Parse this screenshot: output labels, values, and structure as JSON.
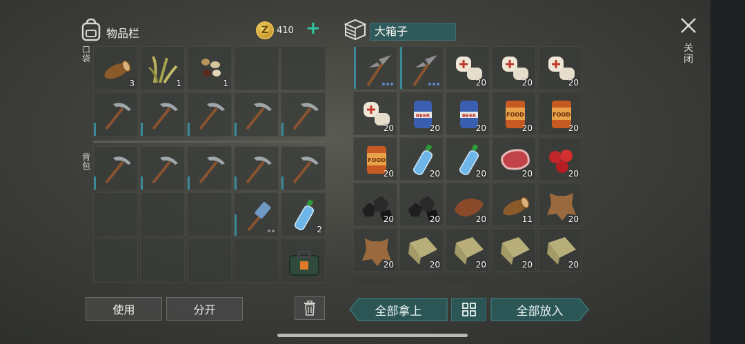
{
  "inventory": {
    "title": "物品栏",
    "coins": "410",
    "coin_symbol": "Z",
    "pocket_label": "口袋",
    "backpack_label": "背包",
    "pocket_row1": [
      {
        "item": "log",
        "qty": "3"
      },
      {
        "item": "plant-fiber",
        "qty": "1"
      },
      {
        "item": "seeds",
        "qty": "1"
      },
      {
        "item": "empty",
        "qty": ""
      },
      {
        "item": "empty",
        "qty": ""
      }
    ],
    "pocket_row2": [
      {
        "item": "pickaxe",
        "qty": ""
      },
      {
        "item": "pickaxe",
        "qty": ""
      },
      {
        "item": "pickaxe",
        "qty": ""
      },
      {
        "item": "pickaxe",
        "qty": ""
      },
      {
        "item": "pickaxe",
        "qty": ""
      }
    ],
    "backpack_row1": [
      {
        "item": "pickaxe",
        "qty": ""
      },
      {
        "item": "pickaxe",
        "qty": ""
      },
      {
        "item": "pickaxe",
        "qty": ""
      },
      {
        "item": "pickaxe",
        "qty": ""
      },
      {
        "item": "pickaxe",
        "qty": ""
      }
    ],
    "backpack_row2": [
      {
        "item": "empty",
        "qty": ""
      },
      {
        "item": "empty",
        "qty": ""
      },
      {
        "item": "empty",
        "qty": ""
      },
      {
        "item": "hammer",
        "qty": ""
      },
      {
        "item": "water-bottle",
        "qty": "2"
      }
    ],
    "backpack_row3": [
      {
        "item": "empty",
        "qty": ""
      },
      {
        "item": "empty",
        "qty": ""
      },
      {
        "item": "empty",
        "qty": ""
      },
      {
        "item": "empty",
        "qty": ""
      },
      {
        "item": "first-aid-kit",
        "qty": ""
      }
    ],
    "use_button": "使用",
    "split_button": "分开"
  },
  "box": {
    "name": "大箱子",
    "rows": [
      [
        {
          "item": "pickaxe-large",
          "qty": ""
        },
        {
          "item": "pickaxe-large",
          "qty": ""
        },
        {
          "item": "bandage",
          "qty": "20"
        },
        {
          "item": "bandage",
          "qty": "20"
        },
        {
          "item": "bandage",
          "qty": "20"
        }
      ],
      [
        {
          "item": "bandage",
          "qty": "20"
        },
        {
          "item": "beer-can",
          "qty": "20"
        },
        {
          "item": "beer-can",
          "qty": "20"
        },
        {
          "item": "food-can",
          "qty": "20"
        },
        {
          "item": "food-can",
          "qty": "20"
        }
      ],
      [
        {
          "item": "food-can",
          "qty": "20"
        },
        {
          "item": "water-bottle",
          "qty": "20"
        },
        {
          "item": "water-bottle",
          "qty": "20"
        },
        {
          "item": "raw-meat",
          "qty": "20"
        },
        {
          "item": "berries",
          "qty": "20"
        }
      ],
      [
        {
          "item": "coal",
          "qty": "20"
        },
        {
          "item": "coal",
          "qty": "20"
        },
        {
          "item": "leather",
          "qty": "20"
        },
        {
          "item": "log",
          "qty": "11"
        },
        {
          "item": "hide",
          "qty": "20"
        }
      ],
      [
        {
          "item": "hide",
          "qty": "20"
        },
        {
          "item": "cloth",
          "qty": "20"
        },
        {
          "item": "cloth",
          "qty": "20"
        },
        {
          "item": "cloth",
          "qty": "20"
        },
        {
          "item": "cloth",
          "qty": "20"
        }
      ]
    ],
    "take_all": "全部拿上",
    "put_all": "全部放入"
  },
  "close_label": "关闭"
}
